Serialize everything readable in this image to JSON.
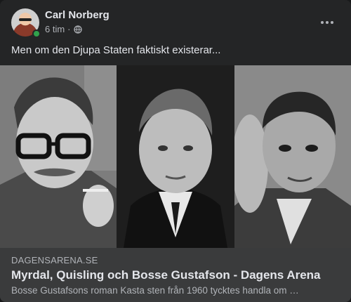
{
  "post": {
    "author": "Carl Norberg",
    "time": "6 tim",
    "separator": "·",
    "audience_icon": "globe-icon",
    "caption": "Men om den Djupa Staten faktiskt existerar...",
    "more_icon": "more-horizontal-icon"
  },
  "link_preview": {
    "domain": "DAGENSARENA.SE",
    "title": "Myrdal, Quisling och Bosse Gustafson - Dagens Arena",
    "description": "Bosse Gustafsons roman Kasta sten från 1960 tycktes handla om …"
  },
  "colors": {
    "card": "#242526",
    "link_box": "#3a3b3c",
    "primary_text": "#e4e6eb",
    "secondary_text": "#b0b3b8",
    "online": "#31a24c"
  }
}
